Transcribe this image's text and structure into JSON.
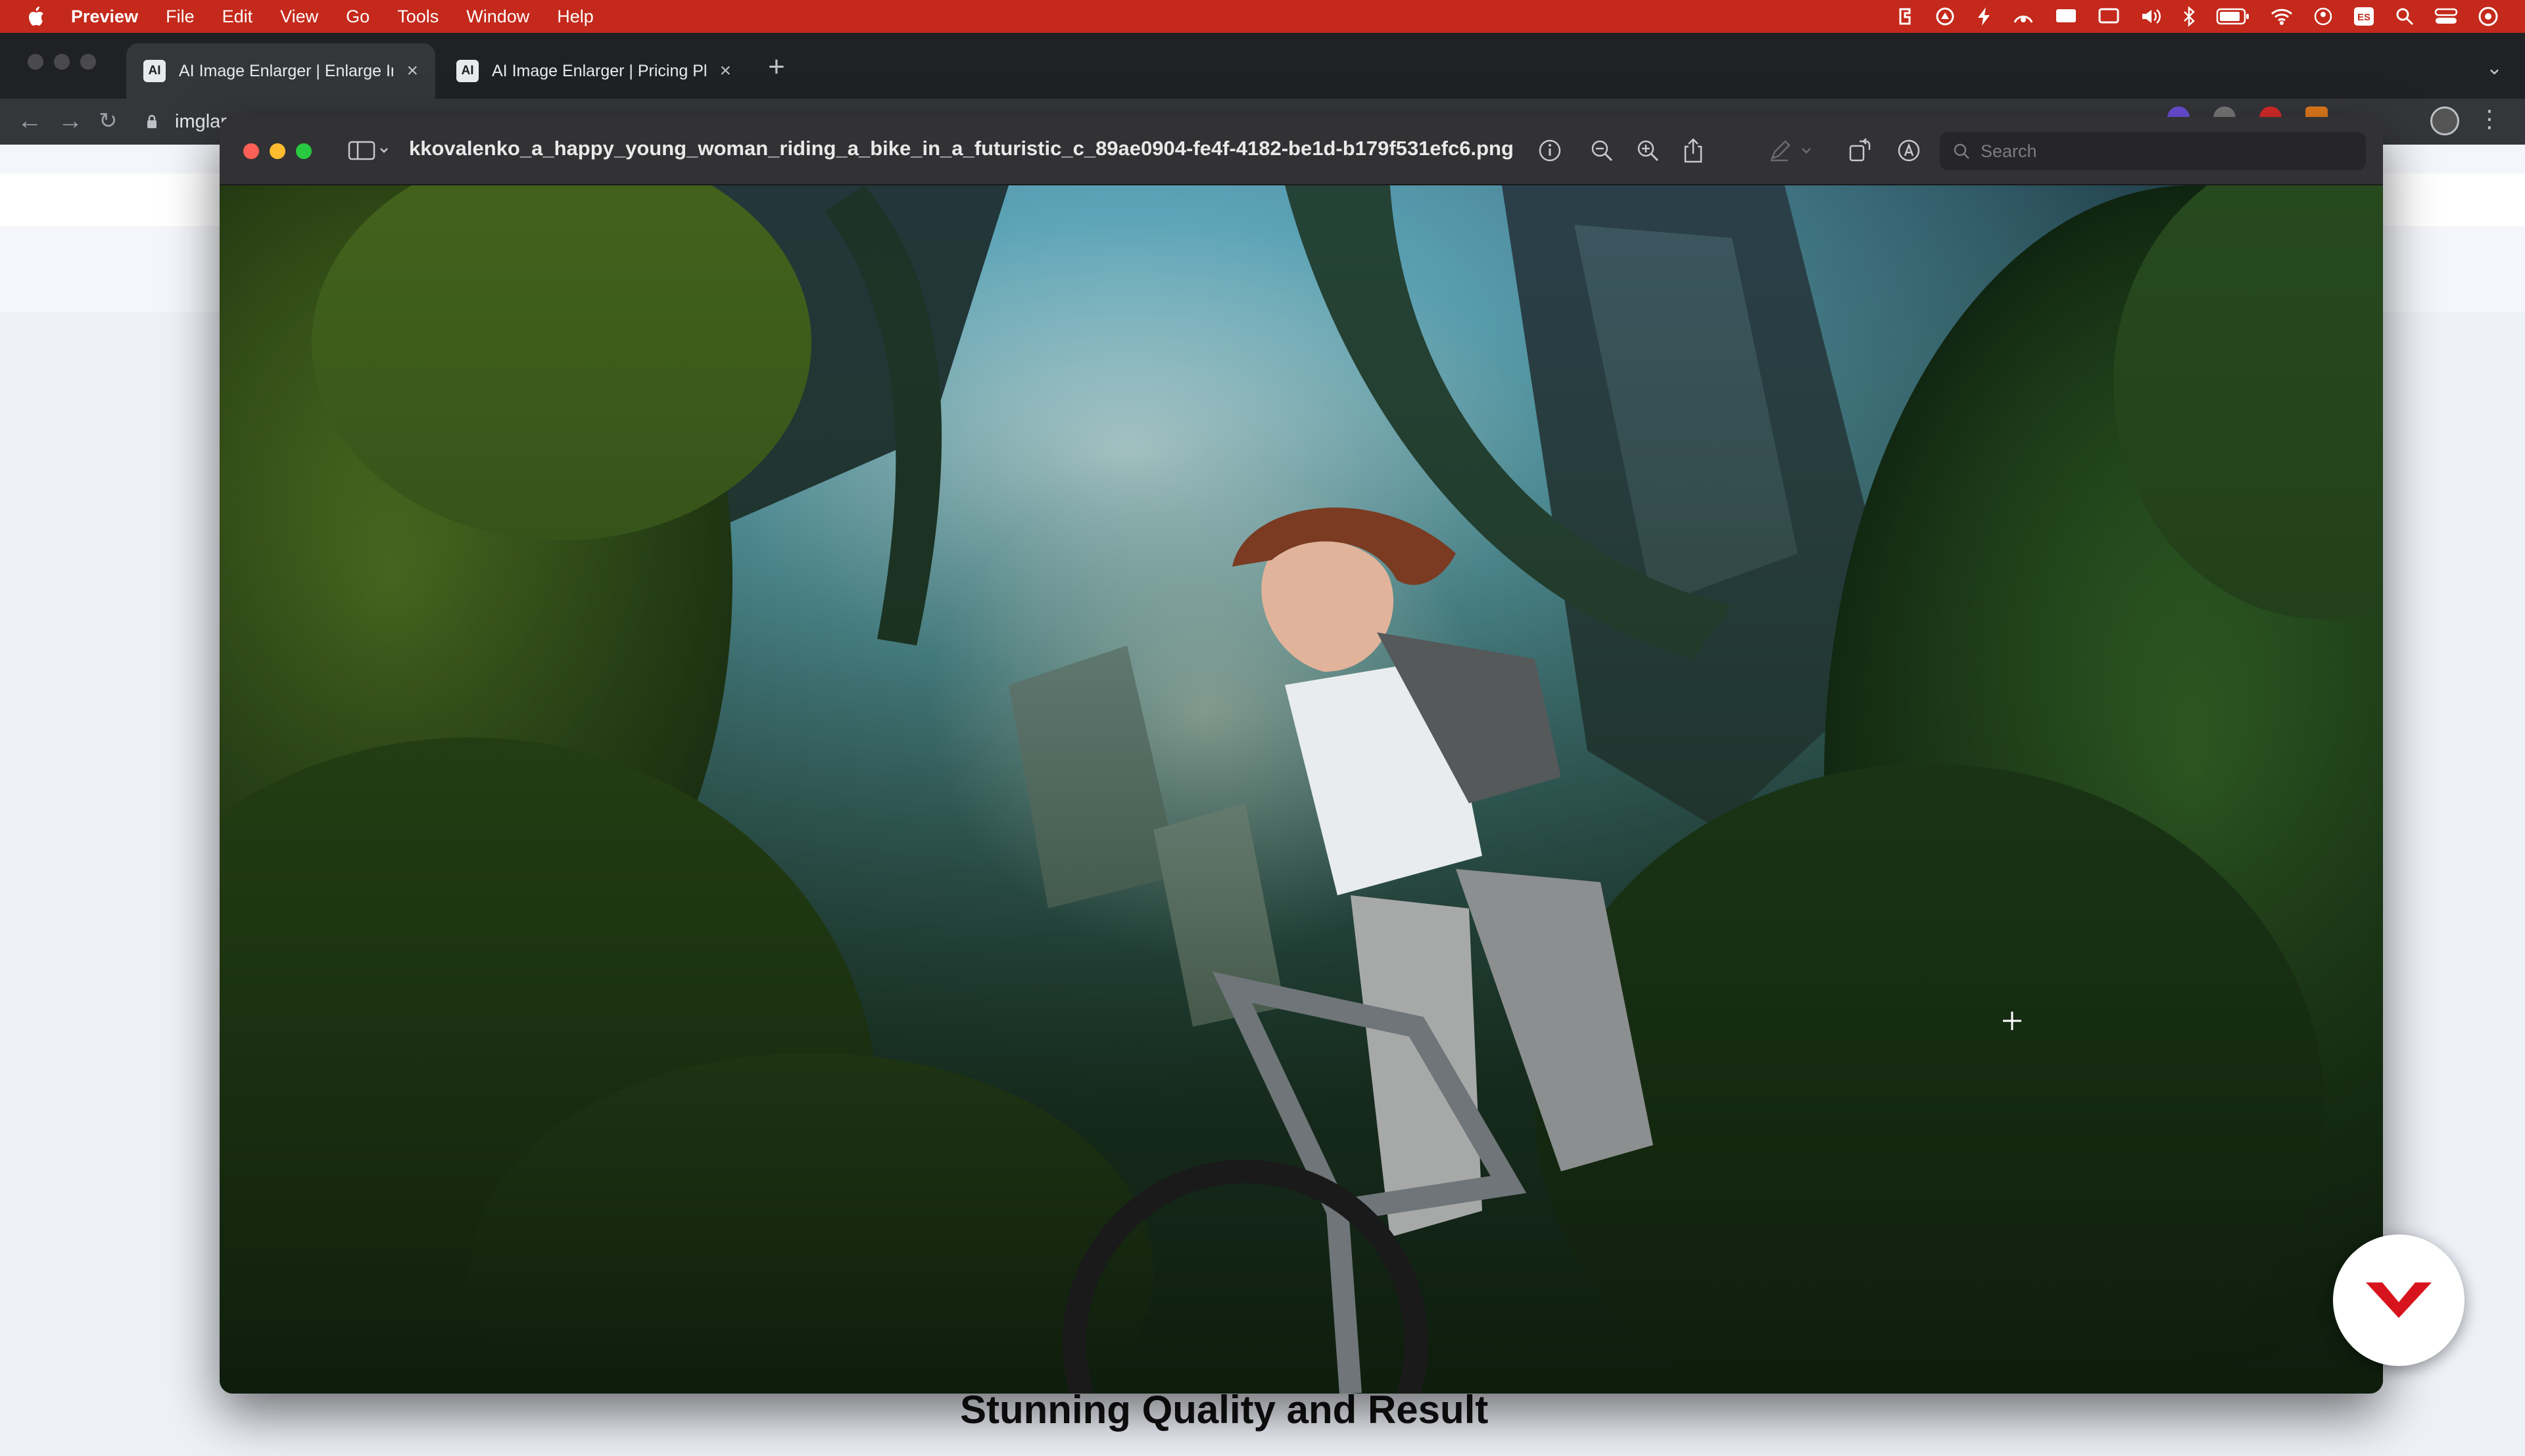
{
  "menubar": {
    "app": "Preview",
    "items": [
      "File",
      "Edit",
      "View",
      "Go",
      "Tools",
      "Window",
      "Help"
    ]
  },
  "browser": {
    "tabs": [
      {
        "title": "AI Image Enlarger | Enlarge Ima",
        "active": true
      },
      {
        "title": "AI Image Enlarger | Pricing Plan",
        "active": false
      }
    ],
    "url": "imglarger.com"
  },
  "preview": {
    "filename": "kkovalenko_a_happy_young_woman_riding_a_bike_in_a_futuristic_c_89ae0904-fe4f-4182-be1d-b179f531efc6.png",
    "search_placeholder": "Search"
  },
  "page": {
    "partial_heading": "Stunning Quality and Result"
  },
  "colors": {
    "menubar": "#c4291b",
    "badge_logo": "#d7141d"
  }
}
